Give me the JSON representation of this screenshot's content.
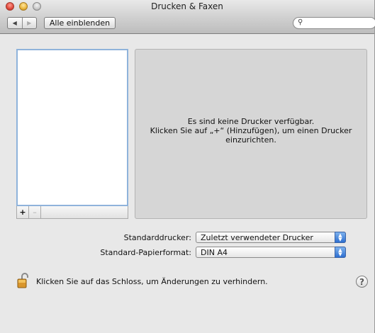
{
  "window": {
    "title": "Drucken & Faxen"
  },
  "toolbar": {
    "back_icon": "◀",
    "forward_icon": "▶",
    "show_all_label": "Alle einblenden",
    "search_value": ""
  },
  "printer_list": {
    "items": [],
    "add_label": "+",
    "remove_label": "–"
  },
  "info_panel": {
    "line1": "Es sind keine Drucker verfügbar.",
    "line2": "Klicken Sie auf „+“ (Hinzufügen), um einen Drucker",
    "line3": "einzurichten."
  },
  "defaults": {
    "printer_label": "Standarddrucker:",
    "printer_value": "Zuletzt verwendeter Drucker",
    "paper_label": "Standard-Papierformat:",
    "paper_value": "DIN A4"
  },
  "footer": {
    "lock_text": "Klicken Sie auf das Schloss, um Änderungen zu verhindern.",
    "help_label": "?"
  },
  "colors": {
    "selection_border": "#8fb3db",
    "popup_accent": "#2d6fd0"
  }
}
